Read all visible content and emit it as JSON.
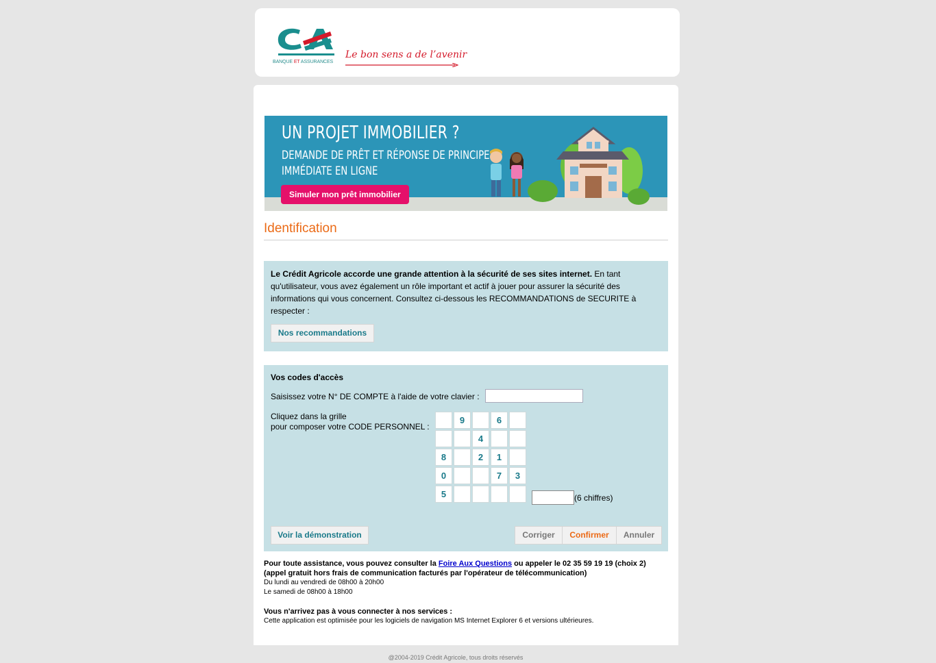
{
  "header": {
    "logo_sub_left": "BANQUE ",
    "logo_sub_mid": "ET",
    "logo_sub_right": " ASSURANCES",
    "slogan": "Le bon sens a de l’avenir"
  },
  "banner": {
    "line1": "UN PROJET IMMOBILIER ?",
    "line2": "DEMANDE DE PRÊT ET RÉPONSE DE PRINCIPE",
    "line3": "IMMÉDIATE EN LIGNE",
    "button": "Simuler mon prêt immobilier"
  },
  "page_title": "Identification",
  "security": {
    "bold_text": "Le Crédit Agricole accorde une grande attention à la sécurité de ses sites internet.",
    "text": " En tant qu'utilisateur, vous avez également un rôle important et actif à jouer pour assurer la sécurité des informations qui vous concernent. Consultez ci-dessous les RECOMMANDATIONS de SECURITE à respecter :",
    "button": "Nos recommandations"
  },
  "codes": {
    "title": "Vos codes d'accès",
    "account_label": "Saisissez votre N° DE COMPTE à l'aide de votre clavier :",
    "account_value": "",
    "grid_label_1": "Cliquez dans la grille",
    "grid_label_2": "pour composer votre CODE PERSONNEL :",
    "grid": [
      "",
      "9",
      "",
      "6",
      "",
      "",
      "",
      "4",
      "",
      "",
      "8",
      "",
      "2",
      "1",
      "",
      "0",
      "",
      "",
      "7",
      "3",
      "5",
      "",
      "",
      "",
      ""
    ],
    "code_value": "",
    "code_hint": "(6 chiffres)",
    "demo_button": "Voir la démonstration",
    "correct_button": "Corriger",
    "confirm_button": "Confirmer",
    "cancel_button": "Annuler"
  },
  "assistance": {
    "line1_a": "Pour toute assistance, vous pouvez consulter la ",
    "faq_link": "Foire Aux Questions",
    "line1_b": " ou appeler le 02 35 59 19 19 (choix 2)",
    "line2": "(appel gratuit hors frais de communication facturés par l'opérateur de télécommunication)",
    "hours1": "Du lundi au vendredi de 08h00 à 20h00",
    "hours2": "Le samedi de 08h00 à 18h00",
    "connect_title": "Vous n'arrivez pas à vous connecter à nos services :",
    "connect_text": "Cette application est optimisée pour les logiciels de navigation MS Internet Explorer 6 et versions ultérieures."
  },
  "footer": "@2004-2019 Crédit Agricole, tous droits réservés",
  "colors": {
    "accent_orange": "#eb6a16",
    "teal": "#1a7a8a",
    "box_bg": "#c6e0e5",
    "brand_red": "#d41a2a",
    "banner_blue": "#2c95b8",
    "cta_pink": "#e5106a"
  }
}
